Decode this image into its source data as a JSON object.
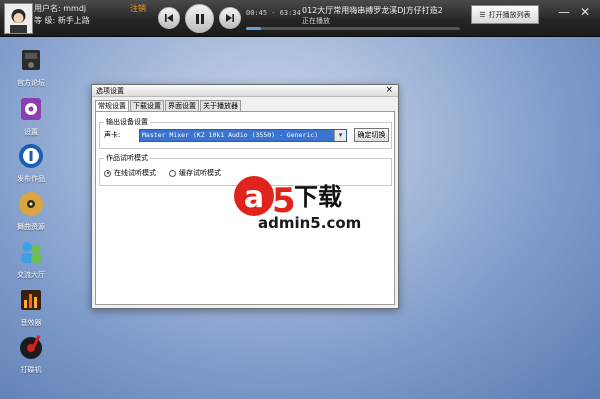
{
  "user": {
    "name_line": "用户名: mmdj",
    "level_line": "等  级: 新手上路",
    "logout": "注销"
  },
  "player": {
    "time": "00:45 - 63:34",
    "song": "012大厅常用嗨串搏罗龙溪DJ方仔打造2",
    "status": "正在播放",
    "progress": 0.07,
    "playlist_button": "打开播放列表"
  },
  "window_controls": {
    "minimize": "—",
    "close": "✕"
  },
  "sidebar": {
    "items": [
      {
        "label": "官方论坛",
        "icon": "forum-icon"
      },
      {
        "label": "设置",
        "icon": "settings-icon"
      },
      {
        "label": "发布作品",
        "icon": "upload-icon"
      },
      {
        "label": "舞曲资源",
        "icon": "music-icon"
      },
      {
        "label": "交流大厅",
        "icon": "chat-icon"
      },
      {
        "label": "音效器",
        "icon": "equalizer-icon"
      },
      {
        "label": "打碟机",
        "icon": "turntable-icon"
      }
    ]
  },
  "dialog": {
    "title": "选项设置",
    "close": "×",
    "tabs": [
      "常规设置",
      "下载设置",
      "界面设置",
      "关于播放器"
    ],
    "output_group": {
      "title": "输出设备设置",
      "card_label": "声卡:",
      "device": "Master Mixer (KZ 10k1 Audio (3550) - Generic)",
      "confirm": "确定切换"
    },
    "preview_group": {
      "title": "作品试听模式",
      "options": [
        {
          "label": "在线试听模式",
          "selected": true
        },
        {
          "label": "缓存试听模式",
          "selected": false
        }
      ]
    }
  },
  "watermark": {
    "title": "下载",
    "letter": "a",
    "digit": "5",
    "url": "admin5.com"
  },
  "colors": {
    "accent": "#3b74d0",
    "logout": "#ff9a1a",
    "watermark": "#e1241b"
  }
}
